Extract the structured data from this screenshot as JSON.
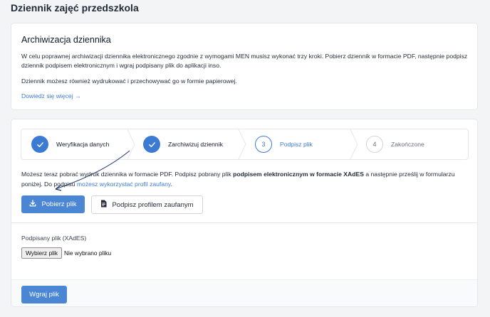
{
  "page": {
    "title": "Dziennik zajęć przedszkola"
  },
  "archive": {
    "heading": "Archiwizacja dziennika",
    "paragraph1": "W celu poprawnej archiwizacji dziennika elektronicznego zgodnie z wymogami MEN musisz wykonać trzy kroki. Pobierz dziennik w formacie PDF, następnie podpisz dziennik podpisem elektronicznym i wgraj podpisany plik do aplikacji inso.",
    "paragraph2": "Dziennik możesz również wydrukować i przechowywać go w formie papierowej.",
    "learn_more": "Dowiedz się więcej →"
  },
  "steps": [
    {
      "number": "",
      "label": "Weryfikacja danych",
      "state": "done"
    },
    {
      "number": "",
      "label": "Zarchiwizuj dziennik",
      "state": "done"
    },
    {
      "number": "3",
      "label": "Podpisz plik",
      "state": "current"
    },
    {
      "number": "4",
      "label": "Zakończone",
      "state": "todo"
    }
  ],
  "info": {
    "text_before": "Możesz teraz pobrać wydruk dziennika w formacie PDF. Podpisz pobrany plik ",
    "bold": "podpisem elektronicznym w formacie XAdES",
    "text_after": " a następnie prześlij w formularzu poniżej. Do podpisu ",
    "link": "możesz wykorzystać profil zaufany",
    "text_end": "."
  },
  "buttons": {
    "download": "Pobierz plik",
    "sign_trusted": "Podpisz profilem zaufanym",
    "upload": "Wgraj plik"
  },
  "file": {
    "label": "Podpisany plik (XAdES)",
    "choose_button": "Wybierz plik",
    "status": "Nie wybrano pliku"
  },
  "colors": {
    "accent": "#4a86d4",
    "link": "#3b7bd4",
    "background": "#f3f4f6"
  },
  "icons": {
    "step_done": "check-icon",
    "download": "download-icon",
    "document": "document-signature-icon"
  }
}
